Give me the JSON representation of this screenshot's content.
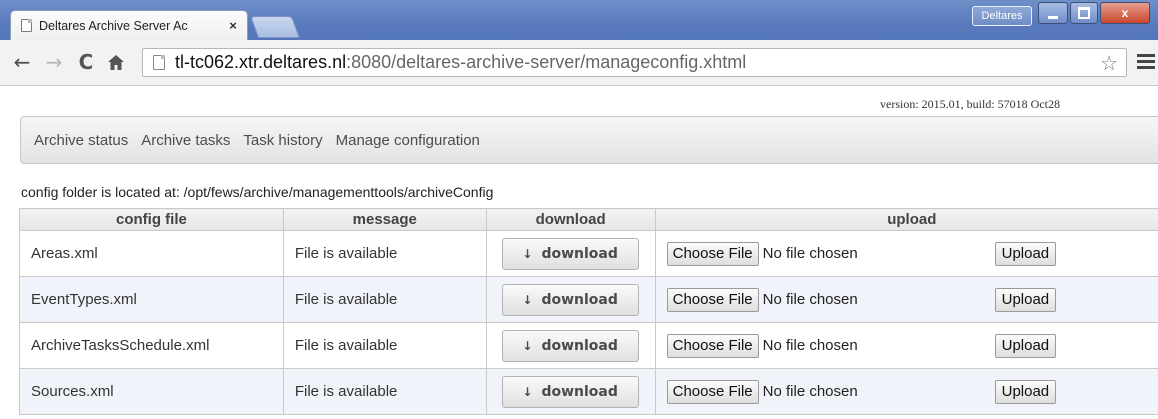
{
  "browser": {
    "tab_title": "Deltares Archive Server Ac",
    "tab_close": "×",
    "profile_label": "Deltares",
    "close_glyph": "x",
    "url_host": "tl-tc062.xtr.deltares.nl",
    "url_rest": ":8080/deltares-archive-server/manageconfig.xhtml",
    "icons": {
      "back": "back-arrow-icon",
      "forward": "forward-arrow-icon",
      "reload": "reload-icon",
      "home": "home-icon",
      "bookmark": "star-icon",
      "menu": "hamburger-menu-icon"
    }
  },
  "page": {
    "version_text": "version: 2015.01, build: 57018 Oct28",
    "menu": [
      {
        "label": "Archive status"
      },
      {
        "label": "Archive tasks"
      },
      {
        "label": "Task history"
      },
      {
        "label": "Manage configuration"
      }
    ],
    "folder_note": "config folder is located at: /opt/fews/archive/managementtools/archiveConfig",
    "table": {
      "headers": {
        "config_file": "config file",
        "message": "message",
        "download": "download",
        "upload": "upload"
      },
      "rows": [
        {
          "file": "Areas.xml",
          "message": "File is available"
        },
        {
          "file": "EventTypes.xml",
          "message": "File is available"
        },
        {
          "file": "ArchiveTasksSchedule.xml",
          "message": "File is available"
        },
        {
          "file": "Sources.xml",
          "message": "File is available"
        }
      ],
      "download_label": "download",
      "download_arrow": "↓",
      "choose_file_label": "Choose File",
      "no_file_label": "No file chosen",
      "upload_label": "Upload"
    }
  }
}
